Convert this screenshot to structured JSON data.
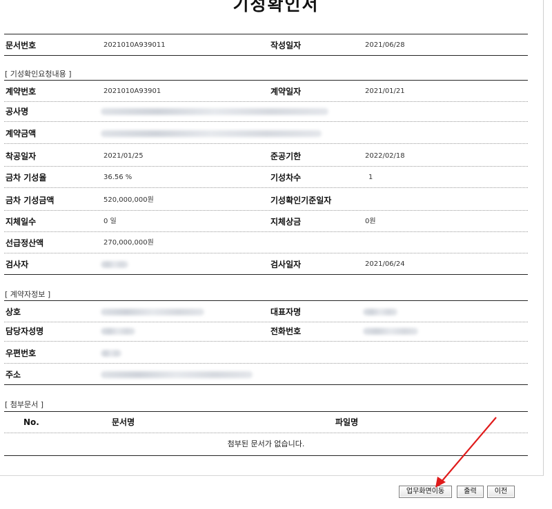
{
  "title": "기성확인서",
  "doc": {
    "doc_no_label": "문서번호",
    "doc_no": "2021010A939011",
    "write_date_label": "작성일자",
    "write_date": "2021/06/28"
  },
  "sections": {
    "request": "[ 기성확인요청내용 ]",
    "contractor": "[ 계약자정보 ]",
    "attachments": "[ 첨부문서 ]"
  },
  "request": {
    "contract_no_label": "계약번호",
    "contract_no": "2021010A93901",
    "contract_date_label": "계약일자",
    "contract_date": "2021/01/21",
    "project_name_label": "공사명",
    "contract_amount_label": "계약금액",
    "start_date_label": "착공일자",
    "start_date": "2021/01/25",
    "completion_label": "준공기한",
    "completion": "2022/02/18",
    "rate_label": "금차 기성율",
    "rate": "36.56 %",
    "installment_label": "기성차수",
    "installment": "1",
    "amount_label": "금차 기성금액",
    "amount": "520,000,000원",
    "base_date_label": "기성확인기준일자",
    "delay_days_label": "지체일수",
    "delay_days": "0 일",
    "delay_penalty_label": "지체상금",
    "delay_penalty": "0원",
    "advance_label": "선급정산액",
    "advance": "270,000,000원",
    "inspector_label": "검사자",
    "inspect_date_label": "검사일자",
    "inspect_date": "2021/06/24"
  },
  "contractor": {
    "company_label": "상호",
    "ceo_label": "대표자명",
    "manager_label": "담당자성명",
    "phone_label": "전화번호",
    "zip_label": "우편번호",
    "address_label": "주소"
  },
  "attachments": {
    "columns": [
      "No.",
      "문서명",
      "파일명"
    ],
    "empty_message": "첨부된 문서가 없습니다."
  },
  "buttons": {
    "move": "업무화면이동",
    "print": "출력",
    "prev": "이전"
  },
  "colors": {
    "arrow": "#e01b1b"
  }
}
